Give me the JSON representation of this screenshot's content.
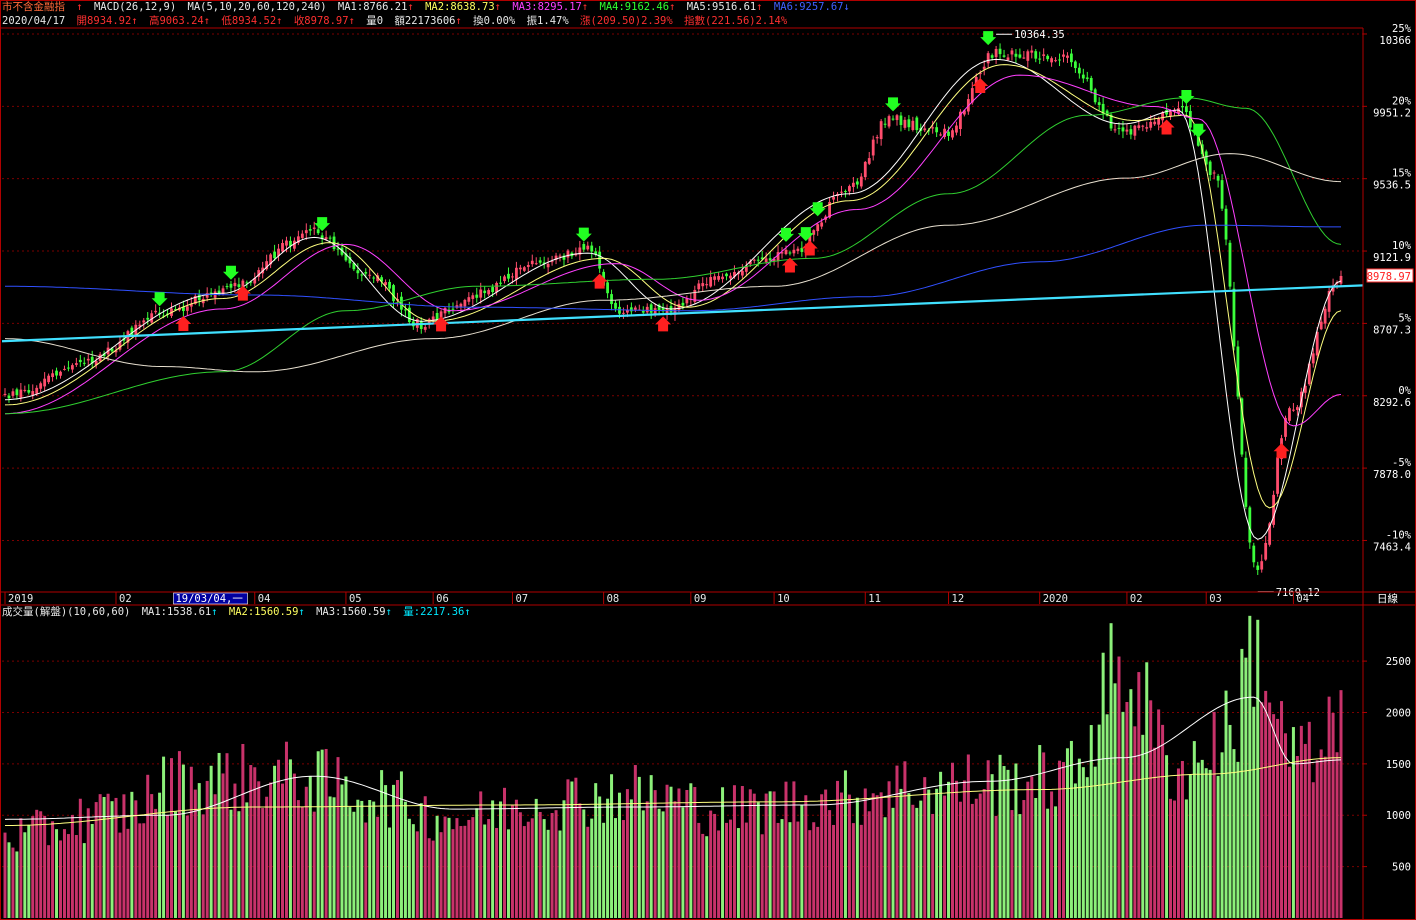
{
  "price_header": {
    "name": "市不含金融指",
    "macd": "MACD(26,12,9)",
    "ma_set": "MA(5,10,20,60,120,240)",
    "ma1": "MA1:8766.21",
    "ma2": "MA2:8638.73",
    "ma3": "MA3:8295.17",
    "ma4": "MA4:9162.46",
    "ma5": "MA5:9516.61",
    "ma6": "MA6:9257.67"
  },
  "ohlc_header": {
    "date": "2020/04/17",
    "open": "開8934.92",
    "high": "高9063.24",
    "low": "低8934.52",
    "close": "收8978.97",
    "vol": "量0",
    "amount": "額22173606",
    "turnover": "換0.00%",
    "amplitude": "振1.47%",
    "change": "漲(209.50)2.39%",
    "index_change": "指數(221.56)2.14%"
  },
  "volume_header": {
    "title": "成交量(解盤)(10,60,60)",
    "ma1": "MA1:1538.61",
    "ma2": "MA2:1560.59",
    "ma3": "MA3:1560.59",
    "vol": "量:2217.36"
  },
  "colors": {
    "up": "#ff4d6d",
    "down": "#3bff3b",
    "vol_up": "#c8326a",
    "vol_down": "#8cf07a",
    "ma5": "#ffffff",
    "ma10": "#ffff80",
    "ma20": "#ff40ff",
    "ma60": "#30d030",
    "ma120": "#e8e0d0",
    "ma240": "#3050ff",
    "trend": "#40e0ff",
    "grid": "#7a0000",
    "border": "#b00000"
  },
  "period_label": "日線",
  "cursor_date": "19/03/04,一",
  "chart_data": [
    {
      "type": "candlestick",
      "pct_ticks": [
        "25%",
        "20%",
        "15%",
        "10%",
        "5%",
        "0%",
        "-5%",
        "-10%"
      ],
      "pct_values": [
        25,
        20,
        15,
        10,
        5,
        0,
        -5,
        -10
      ],
      "price_ticks": [
        "10366",
        "9951.2",
        "9536.5",
        "9121.9",
        "8707.3",
        "8292.6",
        "7878.0",
        "7463.4"
      ],
      "price_tick_values": [
        10366,
        9951.2,
        9536.5,
        9121.9,
        8707.3,
        8292.6,
        7878.0,
        7463.4
      ],
      "ylim": [
        7168,
        10400
      ],
      "last_close_label": "8978.97",
      "annotations": [
        {
          "text": "10364.35",
          "value": 10364.35,
          "date": "2019-12-18"
        },
        {
          "text": "7169.12",
          "value": 7169.12,
          "date": "2020-03-19"
        }
      ],
      "x_ticks": [
        {
          "text": "2019",
          "date": "2019-01-02"
        },
        {
          "text": "02",
          "date": "2019-02-11"
        },
        {
          "text": "04",
          "date": "2019-04-01"
        },
        {
          "text": "05",
          "date": "2019-05-02"
        },
        {
          "text": "06",
          "date": "2019-06-03"
        },
        {
          "text": "07",
          "date": "2019-07-01"
        },
        {
          "text": "08",
          "date": "2019-08-01"
        },
        {
          "text": "09",
          "date": "2019-09-02"
        },
        {
          "text": "10",
          "date": "2019-10-01"
        },
        {
          "text": "11",
          "date": "2019-11-01"
        },
        {
          "text": "12",
          "date": "2019-12-02"
        },
        {
          "text": "2020",
          "date": "2020-01-02"
        },
        {
          "text": "02",
          "date": "2020-02-03"
        },
        {
          "text": "03",
          "date": "2020-03-02"
        },
        {
          "text": "04",
          "date": "2020-04-01"
        }
      ],
      "price_path": [
        {
          "date": "2019-01-02",
          "close": 8290
        },
        {
          "date": "2019-01-31",
          "close": 8500
        },
        {
          "date": "2019-02-27",
          "close": 8760
        },
        {
          "date": "2019-03-20",
          "close": 8900
        },
        {
          "date": "2019-04-22",
          "close": 9230
        },
        {
          "date": "2019-05-10",
          "close": 8980
        },
        {
          "date": "2019-05-29",
          "close": 8700
        },
        {
          "date": "2019-06-18",
          "close": 8880
        },
        {
          "date": "2019-07-08",
          "close": 9050
        },
        {
          "date": "2019-07-26",
          "close": 9130
        },
        {
          "date": "2019-08-07",
          "close": 8770
        },
        {
          "date": "2019-08-26",
          "close": 8780
        },
        {
          "date": "2019-09-11",
          "close": 8990
        },
        {
          "date": "2019-10-08",
          "close": 9120
        },
        {
          "date": "2019-10-28",
          "close": 9480
        },
        {
          "date": "2019-11-11",
          "close": 9880
        },
        {
          "date": "2019-11-29",
          "close": 9800
        },
        {
          "date": "2019-12-18",
          "close": 10260
        },
        {
          "date": "2020-01-10",
          "close": 10230
        },
        {
          "date": "2020-01-31",
          "close": 9800
        },
        {
          "date": "2020-02-20",
          "close": 9940
        },
        {
          "date": "2020-03-04",
          "close": 9560
        },
        {
          "date": "2020-03-19",
          "close": 7290
        },
        {
          "date": "2020-03-31",
          "close": 8200
        },
        {
          "date": "2020-04-17",
          "close": 8978.97
        }
      ],
      "ma_series": [
        {
          "name": "MA5",
          "color_key": "ma5",
          "points": [
            {
              "date": "2019-01-02",
              "value": 8270
            },
            {
              "date": "2019-03-20",
              "value": 8880
            },
            {
              "date": "2019-04-22",
              "value": 9200
            },
            {
              "date": "2019-05-29",
              "value": 8720
            },
            {
              "date": "2019-07-26",
              "value": 9110
            },
            {
              "date": "2019-08-26",
              "value": 8790
            },
            {
              "date": "2019-10-28",
              "value": 9450
            },
            {
              "date": "2019-12-18",
              "value": 10220
            },
            {
              "date": "2020-01-31",
              "value": 9850
            },
            {
              "date": "2020-02-20",
              "value": 9930
            },
            {
              "date": "2020-03-19",
              "value": 7470
            },
            {
              "date": "2020-04-17",
              "value": 8950
            }
          ]
        },
        {
          "name": "MA10",
          "color_key": "ma10",
          "points": [
            {
              "date": "2019-01-02",
              "value": 8240
            },
            {
              "date": "2019-03-20",
              "value": 8850
            },
            {
              "date": "2019-04-26",
              "value": 9170
            },
            {
              "date": "2019-06-03",
              "value": 8720
            },
            {
              "date": "2019-08-01",
              "value": 9080
            },
            {
              "date": "2019-08-30",
              "value": 8800
            },
            {
              "date": "2019-10-28",
              "value": 9410
            },
            {
              "date": "2019-12-20",
              "value": 10190
            },
            {
              "date": "2020-02-05",
              "value": 9870
            },
            {
              "date": "2020-02-24",
              "value": 9900
            },
            {
              "date": "2020-03-24",
              "value": 7650
            },
            {
              "date": "2020-04-17",
              "value": 8780
            }
          ]
        },
        {
          "name": "MA20",
          "color_key": "ma20",
          "points": [
            {
              "date": "2019-01-02",
              "value": 8190
            },
            {
              "date": "2019-03-20",
              "value": 8790
            },
            {
              "date": "2019-05-02",
              "value": 9160
            },
            {
              "date": "2019-06-10",
              "value": 8780
            },
            {
              "date": "2019-08-06",
              "value": 9050
            },
            {
              "date": "2019-09-04",
              "value": 8840
            },
            {
              "date": "2019-10-30",
              "value": 9360
            },
            {
              "date": "2019-12-26",
              "value": 10130
            },
            {
              "date": "2020-02-12",
              "value": 9950
            },
            {
              "date": "2020-02-27",
              "value": 9880
            },
            {
              "date": "2020-04-01",
              "value": 8120
            },
            {
              "date": "2020-04-17",
              "value": 8300
            }
          ]
        },
        {
          "name": "MA60",
          "color_key": "ma60",
          "points": [
            {
              "date": "2019-01-02",
              "value": 8190
            },
            {
              "date": "2019-03-20",
              "value": 8430
            },
            {
              "date": "2019-05-02",
              "value": 8780
            },
            {
              "date": "2019-06-18",
              "value": 8920
            },
            {
              "date": "2019-08-20",
              "value": 8960
            },
            {
              "date": "2019-10-15",
              "value": 9080
            },
            {
              "date": "2019-12-02",
              "value": 9450
            },
            {
              "date": "2020-01-20",
              "value": 9900
            },
            {
              "date": "2020-02-24",
              "value": 10000
            },
            {
              "date": "2020-03-16",
              "value": 9940
            },
            {
              "date": "2020-04-17",
              "value": 9160
            }
          ]
        },
        {
          "name": "MA120",
          "color_key": "ma120",
          "points": [
            {
              "date": "2019-01-02",
              "value": 8620
            },
            {
              "date": "2019-02-27",
              "value": 8460
            },
            {
              "date": "2019-04-01",
              "value": 8430
            },
            {
              "date": "2019-06-03",
              "value": 8620
            },
            {
              "date": "2019-08-01",
              "value": 8840
            },
            {
              "date": "2019-10-01",
              "value": 8920
            },
            {
              "date": "2019-12-02",
              "value": 9270
            },
            {
              "date": "2020-02-03",
              "value": 9540
            },
            {
              "date": "2020-03-10",
              "value": 9680
            },
            {
              "date": "2020-04-17",
              "value": 9520
            }
          ]
        },
        {
          "name": "MA240",
          "color_key": "ma240",
          "points": [
            {
              "date": "2019-01-02",
              "value": 8920
            },
            {
              "date": "2019-04-01",
              "value": 8870
            },
            {
              "date": "2019-06-18",
              "value": 8800
            },
            {
              "date": "2019-09-02",
              "value": 8780
            },
            {
              "date": "2019-11-01",
              "value": 8860
            },
            {
              "date": "2020-01-02",
              "value": 9060
            },
            {
              "date": "2020-03-02",
              "value": 9270
            },
            {
              "date": "2020-04-17",
              "value": 9260
            }
          ]
        }
      ],
      "trendline": {
        "color_key": "trend",
        "start": {
          "date": "2019-01-02",
          "value": 8605
        },
        "end": {
          "date": "2020-04-17",
          "value": 8925
        }
      },
      "signals": [
        {
          "date": "2019-02-26",
          "dir": "down"
        },
        {
          "date": "2019-03-06",
          "dir": "up"
        },
        {
          "date": "2019-03-22",
          "dir": "down"
        },
        {
          "date": "2019-03-27",
          "dir": "up"
        },
        {
          "date": "2019-04-24",
          "dir": "down"
        },
        {
          "date": "2019-06-05",
          "dir": "up"
        },
        {
          "date": "2019-07-25",
          "dir": "down"
        },
        {
          "date": "2019-07-31",
          "dir": "up"
        },
        {
          "date": "2019-08-22",
          "dir": "up"
        },
        {
          "date": "2019-10-04",
          "dir": "down"
        },
        {
          "date": "2019-10-07",
          "dir": "up"
        },
        {
          "date": "2019-10-11",
          "dir": "down"
        },
        {
          "date": "2019-10-14",
          "dir": "up"
        },
        {
          "date": "2019-10-16",
          "dir": "down"
        },
        {
          "date": "2019-11-12",
          "dir": "down"
        },
        {
          "date": "2019-12-12",
          "dir": "up"
        },
        {
          "date": "2019-12-16",
          "dir": "down"
        },
        {
          "date": "2020-02-17",
          "dir": "up"
        },
        {
          "date": "2020-02-24",
          "dir": "down"
        },
        {
          "date": "2020-02-27",
          "dir": "down"
        },
        {
          "date": "2020-03-27",
          "dir": "up"
        }
      ]
    },
    {
      "type": "bar",
      "title": "成交量(解盤)(10,60,60)",
      "y_ticks": [
        2500,
        2000,
        1500,
        1000,
        500
      ],
      "ylim": [
        0,
        2900
      ],
      "volume_path": [
        {
          "date": "2019-01-02",
          "value": 820
        },
        {
          "date": "2019-02-11",
          "value": 1050
        },
        {
          "date": "2019-03-06",
          "value": 1380
        },
        {
          "date": "2019-04-15",
          "value": 1420
        },
        {
          "date": "2019-05-10",
          "value": 1250
        },
        {
          "date": "2019-06-10",
          "value": 1000
        },
        {
          "date": "2019-07-15",
          "value": 1180
        },
        {
          "date": "2019-08-12",
          "value": 1250
        },
        {
          "date": "2019-09-16",
          "value": 1080
        },
        {
          "date": "2019-10-21",
          "value": 1180
        },
        {
          "date": "2019-11-18",
          "value": 1320
        },
        {
          "date": "2019-12-16",
          "value": 1350
        },
        {
          "date": "2020-01-10",
          "value": 1400
        },
        {
          "date": "2020-01-31",
          "value": 2480
        },
        {
          "date": "2020-02-20",
          "value": 1480
        },
        {
          "date": "2020-03-10",
          "value": 1850
        },
        {
          "date": "2020-03-18",
          "value": 2700
        },
        {
          "date": "2020-03-31",
          "value": 1700
        },
        {
          "date": "2020-04-10",
          "value": 1550
        },
        {
          "date": "2020-04-17",
          "value": 2217.36
        }
      ],
      "ma_series": [
        {
          "name": "MA1",
          "color_key": "ma5",
          "points": [
            {
              "date": "2019-01-02",
              "value": 960
            },
            {
              "date": "2019-02-27",
              "value": 1000
            },
            {
              "date": "2019-04-22",
              "value": 1380
            },
            {
              "date": "2019-06-10",
              "value": 1060
            },
            {
              "date": "2019-08-12",
              "value": 1080
            },
            {
              "date": "2019-10-15",
              "value": 1100
            },
            {
              "date": "2019-12-16",
              "value": 1330
            },
            {
              "date": "2020-01-31",
              "value": 1560
            },
            {
              "date": "2020-03-18",
              "value": 2150
            },
            {
              "date": "2020-04-01",
              "value": 1500
            },
            {
              "date": "2020-04-17",
              "value": 1538.61
            }
          ]
        },
        {
          "name": "MA2",
          "color_key": "ma10",
          "points": [
            {
              "date": "2019-01-02",
              "value": 900
            },
            {
              "date": "2019-04-01",
              "value": 1080
            },
            {
              "date": "2019-07-01",
              "value": 1100
            },
            {
              "date": "2019-10-01",
              "value": 1130
            },
            {
              "date": "2020-01-02",
              "value": 1250
            },
            {
              "date": "2020-03-02",
              "value": 1400
            },
            {
              "date": "2020-04-17",
              "value": 1560.59
            }
          ]
        }
      ]
    }
  ]
}
